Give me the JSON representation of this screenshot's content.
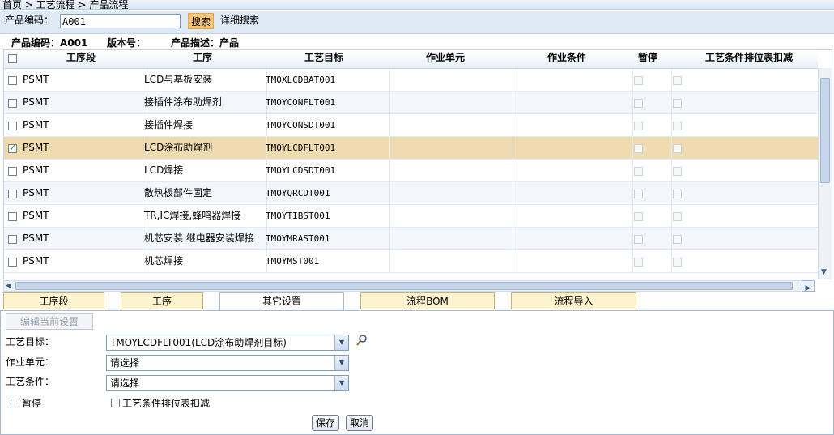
{
  "breadcrumb": "首页 > 工艺流程 > 产品流程",
  "search": {
    "label": "产品编码：",
    "value": "A001",
    "button": "搜索",
    "advanced": "详细搜索"
  },
  "info": {
    "code_label": "产品编码：A001",
    "version_label": "版本号：",
    "desc_label": "产品描述：产品"
  },
  "grid": {
    "headers": [
      "工序段",
      "工序",
      "工艺目标",
      "作业单元",
      "作业条件",
      "暂停",
      "工艺条件排位表扣减"
    ],
    "rows": [
      {
        "segment": "PSMT",
        "process": "LCD与基板安装",
        "target": "TMOXLCDBAT001",
        "checked": false
      },
      {
        "segment": "PSMT",
        "process": "接插件涂布助焊剂",
        "target": "TMOYCONFLT001",
        "checked": false
      },
      {
        "segment": "PSMT",
        "process": "接插件焊接",
        "target": "TMOYCONSDT001",
        "checked": false
      },
      {
        "segment": "PSMT",
        "process": "LCD涂布助焊剂",
        "target": "TMOYLCDFLT001",
        "checked": true
      },
      {
        "segment": "PSMT",
        "process": "LCD焊接",
        "target": "TMOYLCDSDT001",
        "checked": false
      },
      {
        "segment": "PSMT",
        "process": "散热板部件固定",
        "target": "TMOYQRCDT001",
        "checked": false
      },
      {
        "segment": "PSMT",
        "process": "TR,IC焊接,蜂鸣器焊接",
        "target": "TMOYTIBST001",
        "checked": false
      },
      {
        "segment": "PSMT",
        "process": "机芯安装 继电器安装焊接",
        "target": "TMOYMRAST001",
        "checked": false
      },
      {
        "segment": "PSMT",
        "process": "机芯焊接",
        "target": "TMOYMST001",
        "checked": false
      }
    ]
  },
  "tabs": [
    "工序段",
    "工序",
    "其它设置",
    "流程BOM",
    "流程导入"
  ],
  "active_tab": "其它设置",
  "form": {
    "edit_button": "编辑当前设置",
    "target_label": "工艺目标：",
    "target_value": "TMOYLCDFLT001(LCD涂布助焊剂目标)",
    "unit_label": "作业单元：",
    "unit_value": "请选择",
    "condition_label": "工艺条件：",
    "condition_value": "请选择",
    "pause_label": "暂停",
    "deduct_label": "工艺条件排位表扣减",
    "save": "保存",
    "cancel": "取消"
  },
  "icons": {
    "search_icon": "magnifier-icon",
    "dropdown_icon": "chevron-down-icon"
  },
  "colors": {
    "selected_row": "#efdbb0",
    "search_button": "#f6c778",
    "tab_bg": "#fdf3cf"
  }
}
